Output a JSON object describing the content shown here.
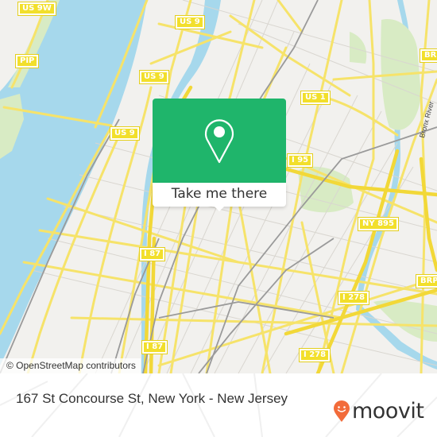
{
  "map": {
    "attribution": "© OpenStreetMap contributors",
    "shields": [
      {
        "label": "US 9W"
      },
      {
        "label": "PIP"
      },
      {
        "label": "US 9"
      },
      {
        "label": "US 9"
      },
      {
        "label": "US 9"
      },
      {
        "label": "US 1"
      },
      {
        "label": "I 95"
      },
      {
        "label": "NY 895"
      },
      {
        "label": "BRP"
      },
      {
        "label": "BRP"
      },
      {
        "label": "I 87"
      },
      {
        "label": "I 87"
      },
      {
        "label": "I 278"
      },
      {
        "label": "I 278"
      }
    ],
    "river_label": "Bronx River",
    "colors": {
      "water": "#a6d8ec",
      "land": "#f2f1ee",
      "park": "#d8ebc4",
      "road": "#f6e36a",
      "rail": "#9a9a9a"
    }
  },
  "popup": {
    "icon": "map-pin-icon",
    "cta_label": "Take me there",
    "color": "#1fb56b"
  },
  "footer": {
    "address": "167 St Concourse St, New York - New Jersey",
    "logo_text": "moovit",
    "logo_icon": "moovit-smiley-pin-icon",
    "logo_color": "#f26b3a"
  }
}
